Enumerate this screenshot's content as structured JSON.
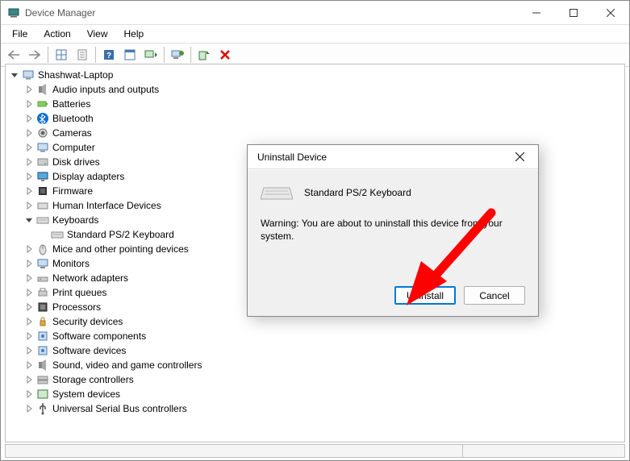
{
  "window": {
    "title": "Device Manager"
  },
  "menubar": {
    "items": [
      "File",
      "Action",
      "View",
      "Help"
    ]
  },
  "toolbar": {
    "buttons": [
      {
        "name": "back",
        "icon": "arrow-left"
      },
      {
        "name": "forward",
        "icon": "arrow-right"
      },
      {
        "sep": true
      },
      {
        "name": "show-hidden",
        "icon": "grid"
      },
      {
        "name": "properties-sheet",
        "icon": "sheet"
      },
      {
        "sep": true
      },
      {
        "name": "help",
        "icon": "help"
      },
      {
        "name": "action-pane",
        "icon": "pane"
      },
      {
        "name": "scan-hardware",
        "icon": "scan"
      },
      {
        "sep": true
      },
      {
        "name": "update-driver",
        "icon": "monitor-up"
      },
      {
        "sep": true
      },
      {
        "name": "enable",
        "icon": "enable"
      },
      {
        "name": "uninstall-device",
        "icon": "red-x"
      }
    ]
  },
  "tree": {
    "root": {
      "label": "Shashwat-Laptop",
      "expanded": true,
      "icon": "computer",
      "children": [
        {
          "label": "Audio inputs and outputs",
          "icon": "speaker"
        },
        {
          "label": "Batteries",
          "icon": "battery"
        },
        {
          "label": "Bluetooth",
          "icon": "bluetooth"
        },
        {
          "label": "Cameras",
          "icon": "camera"
        },
        {
          "label": "Computer",
          "icon": "computer"
        },
        {
          "label": "Disk drives",
          "icon": "disk"
        },
        {
          "label": "Display adapters",
          "icon": "display"
        },
        {
          "label": "Firmware",
          "icon": "chip"
        },
        {
          "label": "Human Interface Devices",
          "icon": "hid"
        },
        {
          "label": "Keyboards",
          "icon": "keyboard",
          "expanded": true,
          "children": [
            {
              "label": "Standard PS/2 Keyboard",
              "icon": "keyboard",
              "leaf": true
            }
          ]
        },
        {
          "label": "Mice and other pointing devices",
          "icon": "mouse"
        },
        {
          "label": "Monitors",
          "icon": "monitor"
        },
        {
          "label": "Network adapters",
          "icon": "network"
        },
        {
          "label": "Print queues",
          "icon": "printer"
        },
        {
          "label": "Processors",
          "icon": "cpu"
        },
        {
          "label": "Security devices",
          "icon": "security"
        },
        {
          "label": "Software components",
          "icon": "software"
        },
        {
          "label": "Software devices",
          "icon": "software"
        },
        {
          "label": "Sound, video and game controllers",
          "icon": "speaker"
        },
        {
          "label": "Storage controllers",
          "icon": "storage"
        },
        {
          "label": "System devices",
          "icon": "system"
        },
        {
          "label": "Universal Serial Bus controllers",
          "icon": "usb"
        }
      ]
    }
  },
  "dialog": {
    "title": "Uninstall Device",
    "device_name": "Standard PS/2 Keyboard",
    "warning": "Warning: You are about to uninstall this device from your system.",
    "primary_button": "Uninstall",
    "secondary_button": "Cancel"
  }
}
